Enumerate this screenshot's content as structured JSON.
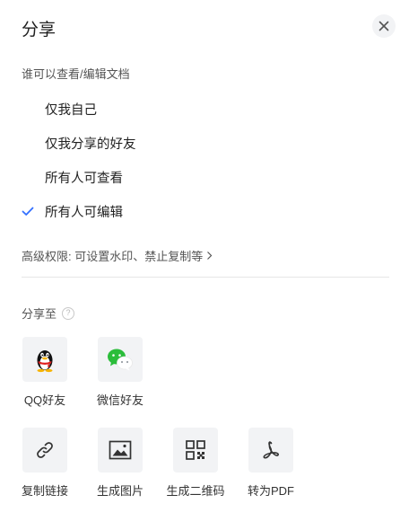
{
  "dialog": {
    "title": "分享"
  },
  "permissions": {
    "heading": "谁可以查看/编辑文档",
    "options": [
      {
        "label": "仅我自己",
        "selected": false
      },
      {
        "label": "仅我分享的好友",
        "selected": false
      },
      {
        "label": "所有人可查看",
        "selected": false
      },
      {
        "label": "所有人可编辑",
        "selected": true
      }
    ],
    "advanced": "高级权限: 可设置水印、禁止复制等",
    "check_color": "#3370ff"
  },
  "share": {
    "heading": "分享至",
    "help_glyph": "?",
    "targets": [
      {
        "label": "QQ好友",
        "icon": "qq-penguin-icon"
      },
      {
        "label": "微信好友",
        "icon": "wechat-icon"
      }
    ],
    "actions": [
      {
        "label": "复制链接",
        "icon": "link-icon"
      },
      {
        "label": "生成图片",
        "icon": "image-icon"
      },
      {
        "label": "生成二维码",
        "icon": "qrcode-icon"
      },
      {
        "label": "转为PDF",
        "icon": "pdf-icon"
      }
    ]
  },
  "colors": {
    "wechat_green": "#2bbd3a",
    "tile_bg": "#f2f3f5"
  }
}
